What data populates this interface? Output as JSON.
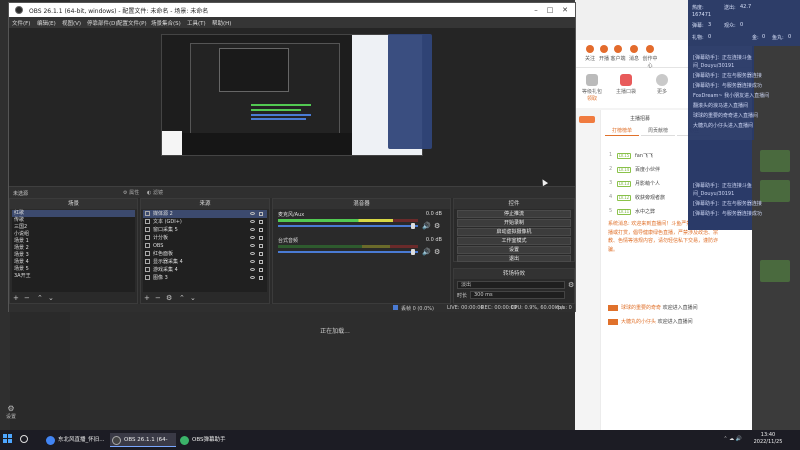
{
  "obs": {
    "title": "OBS 26.1.1 (64-bit, windows) - 配置文件: 未命名 - 场景: 未命名",
    "menu": [
      "文件(F)",
      "编辑(E)",
      "视图(V)",
      "停靠部件(D)",
      "配置文件(P)",
      "场景集合(S)",
      "工具(T)",
      "帮助(H)"
    ],
    "scene_bar": {
      "label": "未选源",
      "properties": "属性",
      "filters": "滤镜"
    },
    "scenes_dock": {
      "title": "场景",
      "items": [
        "红歌",
        "传歌",
        "三国2",
        "小说组",
        "场景 1",
        "场景 2",
        "场景 3",
        "场景 4",
        "场景 5",
        "3A开王"
      ],
      "selected_index": 0
    },
    "sources_dock": {
      "title": "来源",
      "items": [
        "媒体源 2",
        "文本 (GDI+)",
        "窗口采集 5",
        "计分板",
        "OBS",
        "红色面板",
        "显示器采集 4",
        "游戏采集 4",
        "图像 3"
      ],
      "selected_index": 0
    },
    "mixer_dock": {
      "title": "混音器",
      "tracks": [
        {
          "name": "麦克风/Aux",
          "db": "0.0 dB",
          "level": 0.82,
          "volume": 0.98
        },
        {
          "name": "台式音频",
          "db": "0.0 dB",
          "level": 0.0,
          "volume": 0.98
        }
      ]
    },
    "controls_dock": {
      "title": "控件",
      "buttons": [
        "停止推流",
        "开始录制",
        "启动虚拟摄像机",
        "工作室模式",
        "设置",
        "退出"
      ]
    },
    "transitions_dock": {
      "title": "转场特效",
      "transition": "淡出",
      "duration_label": "时长",
      "duration": "300 ms"
    },
    "status": {
      "live": "LIVE: 00:00:00",
      "rec": "REC: 00:00:00",
      "cpu": "CPU: 0.9%, 60.00 fps",
      "kbps": "kb/s: 0",
      "dropped": "丢帧 0 (0.0%)"
    }
  },
  "desktop": {
    "loading_text": "正在加载...",
    "settings_label": "设置"
  },
  "right_panel": {
    "nav": [
      "关注",
      "开播",
      "客户端",
      "消息",
      "创作中心"
    ],
    "tools": [
      {
        "label": "等级礼包",
        "sub": "领取"
      },
      {
        "label": "主播口袋",
        "sub": ""
      },
      {
        "label": "更多",
        "sub": ""
      }
    ],
    "gift_label": "主播招募",
    "tabs": [
      "打榜榜单",
      "周贡献榜",
      "粉丝"
    ],
    "ranks": [
      {
        "num": "1",
        "lvl": "LV.15",
        "name": "fan飞飞"
      },
      {
        "num": "2",
        "lvl": "LV.14",
        "name": "百度小伙伴"
      },
      {
        "num": "3",
        "lvl": "LV.13",
        "name": "月影萌个人"
      },
      {
        "num": "4",
        "lvl": "LV.12",
        "name": "收获旁观者旅"
      },
      {
        "num": "5",
        "lvl": "LV.11",
        "name": "水中之弊"
      }
    ],
    "system_message": "系统消息: 欢迎来到直播间！斗鱼严禁未成年人直播或打赏，倡导健康绿色直播，严禁涉及政治、宗教、色情等违规内容，请勿轻信私下交易，谨防诈骗。",
    "welcome": [
      {
        "user": "球球的重要的奇奇",
        "text": "欢迎进入直播间"
      },
      {
        "user": "大糖丸的小仔头",
        "text": "欢迎进入直播间"
      }
    ]
  },
  "overlay": {
    "stats": [
      {
        "label": "热度:",
        "value": "167471"
      },
      {
        "label": "送出:",
        "value": "42.7"
      },
      {
        "label": "弹幕:",
        "value": "3"
      },
      {
        "label": "观众:",
        "value": "0"
      },
      {
        "label": "礼物:",
        "value": "0"
      },
      {
        "label": "金:",
        "value": "0"
      },
      {
        "label": "鱼丸:",
        "value": "0"
      }
    ],
    "chat": [
      "[弹幕助手]：正在连接斗鱼",
      "间_Douyu/30191",
      "[弹幕助手]：正在与服务器连接",
      "[弹幕助手]：与服务器连接成功",
      "FoxDream~ 我小朋友进入直播间",
      "翻滚头的浪马进入直播间",
      "球球的重要的奇奇进入直播间",
      "大糖丸的小仔头进入直播间"
    ],
    "chat2": [
      "[弹幕助手]：正在连接斗鱼",
      "间_Douyu/30191",
      "[弹幕助手]：正在与服务器连接",
      "[弹幕助手]：与服务器连接成功"
    ]
  },
  "taskbar": {
    "items": [
      {
        "label": "东北风直播_怀旧...",
        "color": "#e8b04a"
      },
      {
        "label": "OBS 26.1.1 (64-bi...",
        "color": "#444"
      },
      {
        "label": "OBS弹幕助手",
        "color": "#3bb36a"
      }
    ],
    "time": "13:40",
    "date": "2022/11/25"
  }
}
